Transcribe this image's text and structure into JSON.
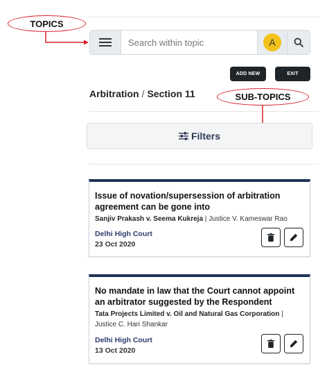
{
  "callouts": {
    "topics": "TOPICS",
    "subtopics": "SUB-TOPICS"
  },
  "search": {
    "placeholder": "Search within topic",
    "avatar_initial": "A"
  },
  "actions": {
    "add_new": "ADD NEW",
    "exit": "EXIT"
  },
  "breadcrumb": {
    "topic": "Arbitration",
    "separator": "/",
    "subtopic": "Section 11"
  },
  "filters": {
    "label": "Filters"
  },
  "cards": [
    {
      "title": "Issue of novation/supersession of arbitration agreement can be gone into",
      "parties": "Sanjiv Prakash v. Seema Kukreja",
      "judge": "Justice V. Kameswar Rao",
      "court": "Delhi High Court",
      "date": "23 Oct 2020"
    },
    {
      "title": "No mandate in law that the Court cannot appoint an arbitrator suggested by the Respondent",
      "parties": "Tata Projects Limited v. Oil and Natural Gas Corporation",
      "judge": "Justice C. Hari Shankar",
      "court": "Delhi High Court",
      "date": "13 Oct 2020"
    }
  ],
  "colors": {
    "accent": "#1f3357",
    "avatar": "#f4c21a",
    "callout": "#d8202a"
  },
  "icons": [
    "menu-icon",
    "search-icon",
    "filter-icon",
    "trash-icon",
    "edit-icon"
  ]
}
